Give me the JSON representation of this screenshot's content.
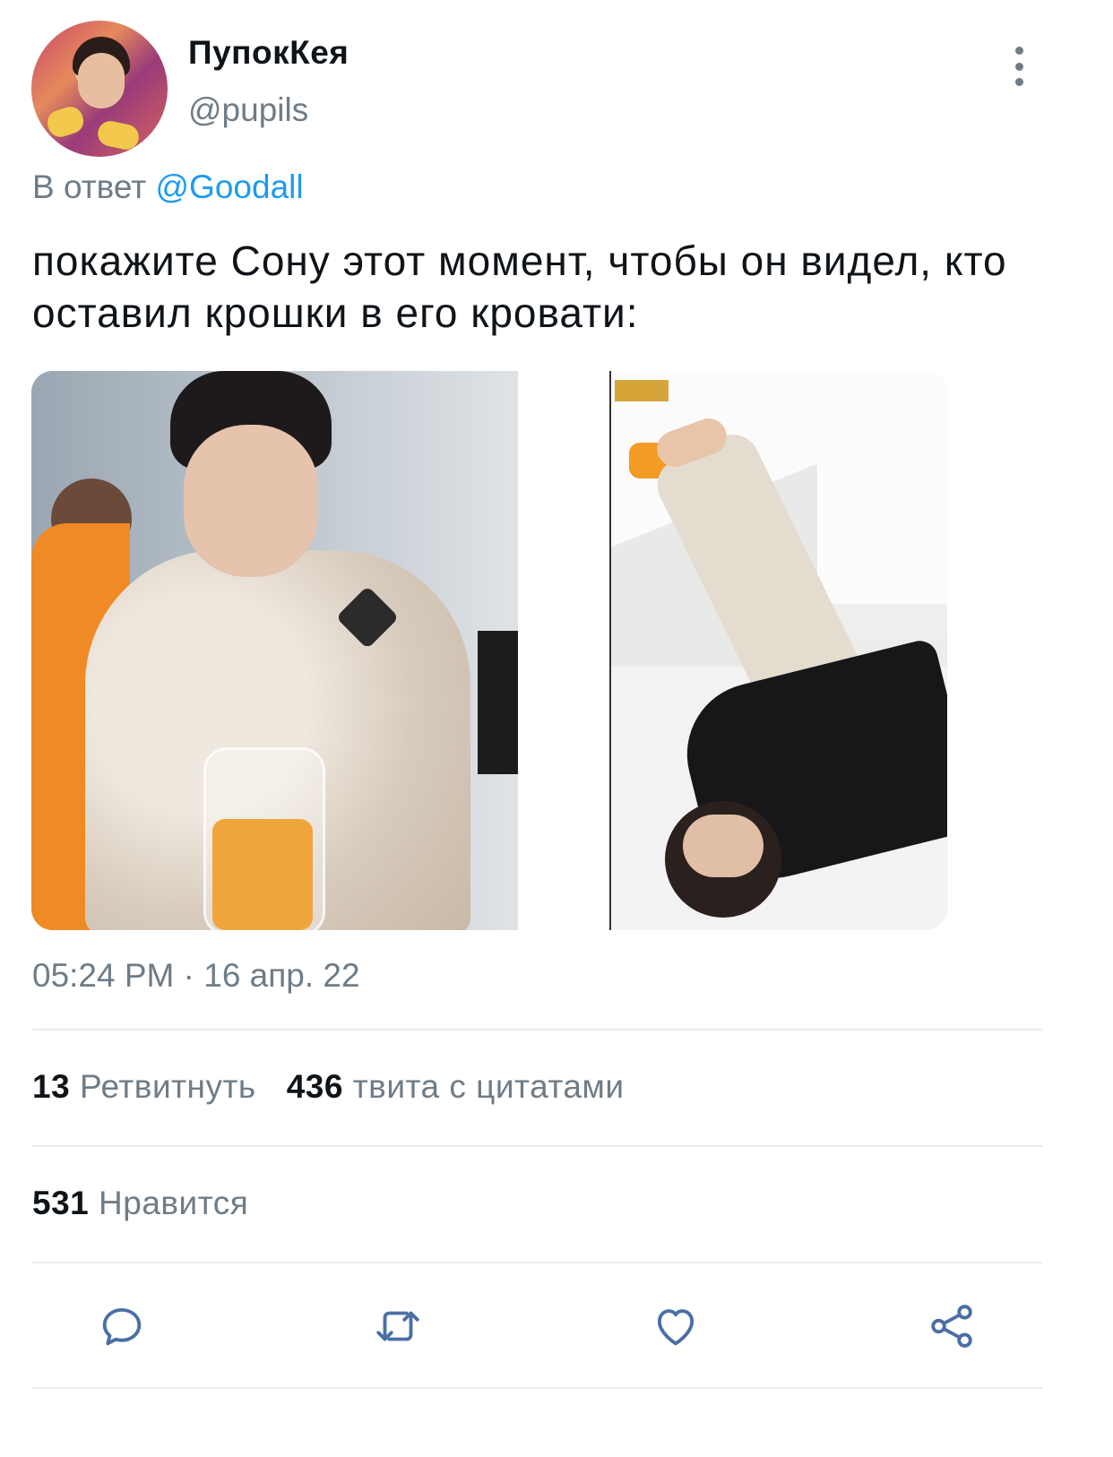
{
  "tweet": {
    "author_name": "ПупокКея",
    "author_handle": "@pupils",
    "reply_prefix": "В ответ",
    "reply_mention": "@Goodall",
    "text": "покажите Сону этот момент, чтобы он видел, кто оставил крошки в его кровати:",
    "timestamp": "05:24 PM · 16 апр. 22"
  },
  "stats": {
    "retweets_count": "13",
    "retweets_label": "Ретвитнуть",
    "quotes_count": "436",
    "quotes_label": "твита с цитатами",
    "likes_count": "531",
    "likes_label": "Нравится"
  },
  "icons": {
    "more": "more-vertical-icon",
    "reply": "reply-icon",
    "retweet": "retweet-icon",
    "like": "heart-icon",
    "share": "share-icon"
  },
  "colors": {
    "link": "#1d9bf0",
    "secondary_text": "#6e7c87",
    "primary_text": "#0f1419",
    "icon": "#4a6fa5"
  }
}
